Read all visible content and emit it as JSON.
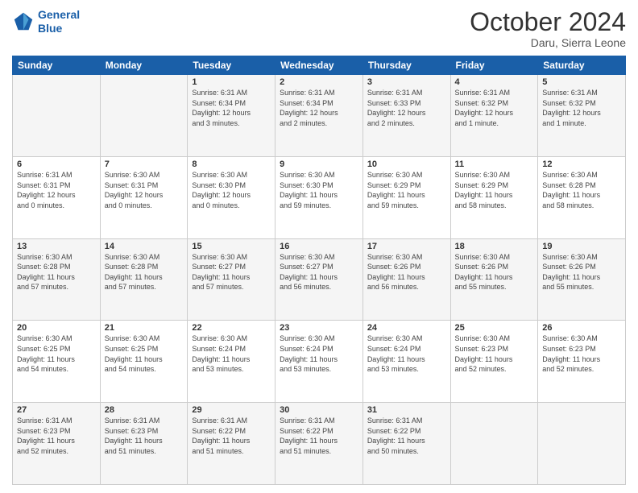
{
  "header": {
    "logo_line1": "General",
    "logo_line2": "Blue",
    "month": "October 2024",
    "location": "Daru, Sierra Leone"
  },
  "weekdays": [
    "Sunday",
    "Monday",
    "Tuesday",
    "Wednesday",
    "Thursday",
    "Friday",
    "Saturday"
  ],
  "weeks": [
    [
      {
        "day": "",
        "info": ""
      },
      {
        "day": "",
        "info": ""
      },
      {
        "day": "1",
        "info": "Sunrise: 6:31 AM\nSunset: 6:34 PM\nDaylight: 12 hours\nand 3 minutes."
      },
      {
        "day": "2",
        "info": "Sunrise: 6:31 AM\nSunset: 6:34 PM\nDaylight: 12 hours\nand 2 minutes."
      },
      {
        "day": "3",
        "info": "Sunrise: 6:31 AM\nSunset: 6:33 PM\nDaylight: 12 hours\nand 2 minutes."
      },
      {
        "day": "4",
        "info": "Sunrise: 6:31 AM\nSunset: 6:32 PM\nDaylight: 12 hours\nand 1 minute."
      },
      {
        "day": "5",
        "info": "Sunrise: 6:31 AM\nSunset: 6:32 PM\nDaylight: 12 hours\nand 1 minute."
      }
    ],
    [
      {
        "day": "6",
        "info": "Sunrise: 6:31 AM\nSunset: 6:31 PM\nDaylight: 12 hours\nand 0 minutes."
      },
      {
        "day": "7",
        "info": "Sunrise: 6:30 AM\nSunset: 6:31 PM\nDaylight: 12 hours\nand 0 minutes."
      },
      {
        "day": "8",
        "info": "Sunrise: 6:30 AM\nSunset: 6:30 PM\nDaylight: 12 hours\nand 0 minutes."
      },
      {
        "day": "9",
        "info": "Sunrise: 6:30 AM\nSunset: 6:30 PM\nDaylight: 11 hours\nand 59 minutes."
      },
      {
        "day": "10",
        "info": "Sunrise: 6:30 AM\nSunset: 6:29 PM\nDaylight: 11 hours\nand 59 minutes."
      },
      {
        "day": "11",
        "info": "Sunrise: 6:30 AM\nSunset: 6:29 PM\nDaylight: 11 hours\nand 58 minutes."
      },
      {
        "day": "12",
        "info": "Sunrise: 6:30 AM\nSunset: 6:28 PM\nDaylight: 11 hours\nand 58 minutes."
      }
    ],
    [
      {
        "day": "13",
        "info": "Sunrise: 6:30 AM\nSunset: 6:28 PM\nDaylight: 11 hours\nand 57 minutes."
      },
      {
        "day": "14",
        "info": "Sunrise: 6:30 AM\nSunset: 6:28 PM\nDaylight: 11 hours\nand 57 minutes."
      },
      {
        "day": "15",
        "info": "Sunrise: 6:30 AM\nSunset: 6:27 PM\nDaylight: 11 hours\nand 57 minutes."
      },
      {
        "day": "16",
        "info": "Sunrise: 6:30 AM\nSunset: 6:27 PM\nDaylight: 11 hours\nand 56 minutes."
      },
      {
        "day": "17",
        "info": "Sunrise: 6:30 AM\nSunset: 6:26 PM\nDaylight: 11 hours\nand 56 minutes."
      },
      {
        "day": "18",
        "info": "Sunrise: 6:30 AM\nSunset: 6:26 PM\nDaylight: 11 hours\nand 55 minutes."
      },
      {
        "day": "19",
        "info": "Sunrise: 6:30 AM\nSunset: 6:26 PM\nDaylight: 11 hours\nand 55 minutes."
      }
    ],
    [
      {
        "day": "20",
        "info": "Sunrise: 6:30 AM\nSunset: 6:25 PM\nDaylight: 11 hours\nand 54 minutes."
      },
      {
        "day": "21",
        "info": "Sunrise: 6:30 AM\nSunset: 6:25 PM\nDaylight: 11 hours\nand 54 minutes."
      },
      {
        "day": "22",
        "info": "Sunrise: 6:30 AM\nSunset: 6:24 PM\nDaylight: 11 hours\nand 53 minutes."
      },
      {
        "day": "23",
        "info": "Sunrise: 6:30 AM\nSunset: 6:24 PM\nDaylight: 11 hours\nand 53 minutes."
      },
      {
        "day": "24",
        "info": "Sunrise: 6:30 AM\nSunset: 6:24 PM\nDaylight: 11 hours\nand 53 minutes."
      },
      {
        "day": "25",
        "info": "Sunrise: 6:30 AM\nSunset: 6:23 PM\nDaylight: 11 hours\nand 52 minutes."
      },
      {
        "day": "26",
        "info": "Sunrise: 6:30 AM\nSunset: 6:23 PM\nDaylight: 11 hours\nand 52 minutes."
      }
    ],
    [
      {
        "day": "27",
        "info": "Sunrise: 6:31 AM\nSunset: 6:23 PM\nDaylight: 11 hours\nand 52 minutes."
      },
      {
        "day": "28",
        "info": "Sunrise: 6:31 AM\nSunset: 6:23 PM\nDaylight: 11 hours\nand 51 minutes."
      },
      {
        "day": "29",
        "info": "Sunrise: 6:31 AM\nSunset: 6:22 PM\nDaylight: 11 hours\nand 51 minutes."
      },
      {
        "day": "30",
        "info": "Sunrise: 6:31 AM\nSunset: 6:22 PM\nDaylight: 11 hours\nand 51 minutes."
      },
      {
        "day": "31",
        "info": "Sunrise: 6:31 AM\nSunset: 6:22 PM\nDaylight: 11 hours\nand 50 minutes."
      },
      {
        "day": "",
        "info": ""
      },
      {
        "day": "",
        "info": ""
      }
    ]
  ]
}
